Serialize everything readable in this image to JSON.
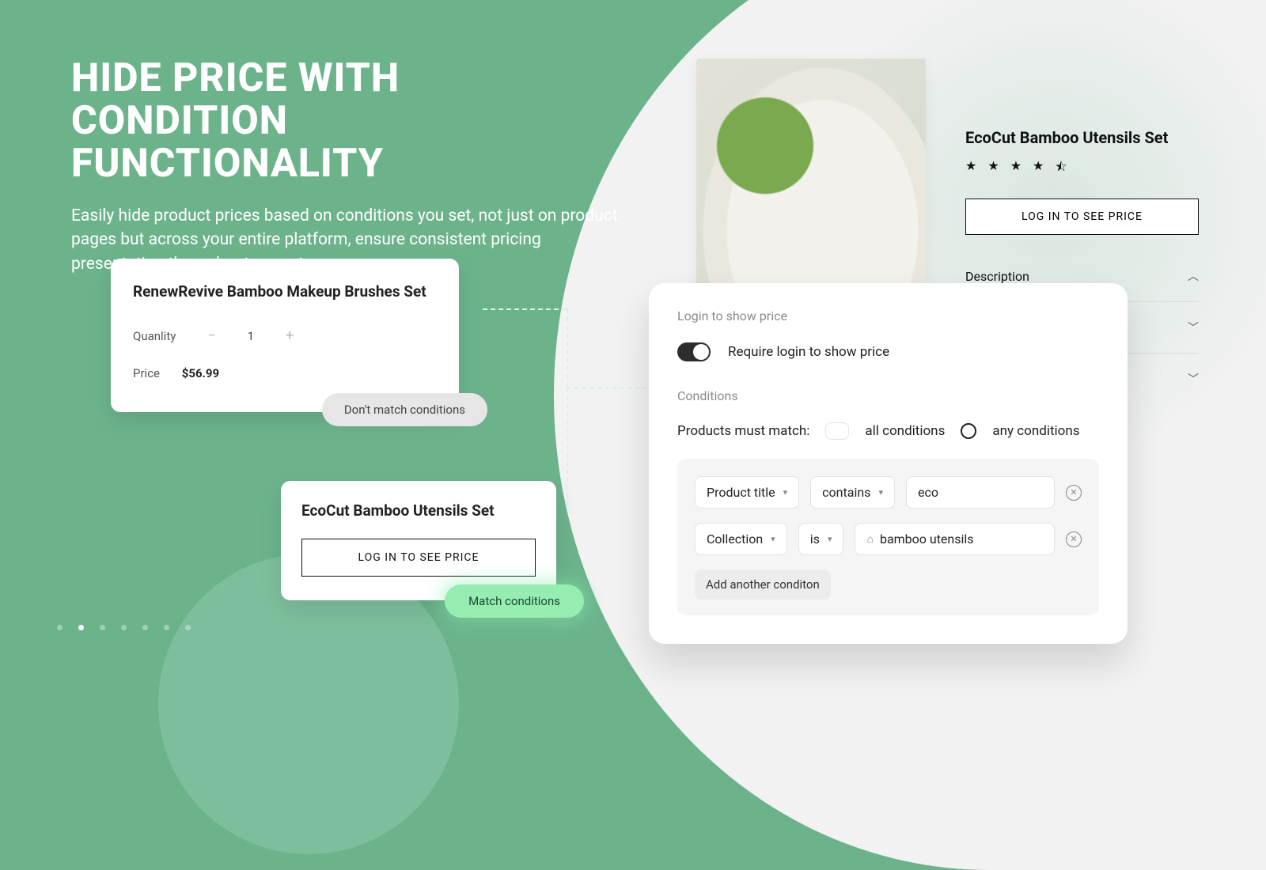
{
  "heading": {
    "title_line1": "HIDE PRICE WITH CONDITION",
    "title_line2": "FUNCTIONALITY",
    "subtitle": "Easily hide product prices based on conditions you set, not just on product pages but across your entire platform, ensure consistent pricing presentation throughout your store."
  },
  "card_a": {
    "title": "RenewRevive Bamboo Makeup Brushes Set",
    "qty_label": "Quanlity",
    "qty_value": "1",
    "price_label": "Price",
    "price_value": "$56.99",
    "badge": "Don't match conditions"
  },
  "card_b": {
    "title": "EcoCut Bamboo Utensils Set",
    "login_btn": "LOG IN TO SEE PRICE",
    "badge": "Match conditions"
  },
  "product": {
    "title": "EcoCut Bamboo Utensils Set",
    "login_btn": "LOG IN TO SEE PRICE",
    "acc1": "Description"
  },
  "settings": {
    "section1": "Login to show price",
    "toggle_label": "Require login to show price",
    "section2": "Conditions",
    "match_prompt": "Products must match:",
    "match_all": "all conditions",
    "match_any": "any conditions",
    "row1_field": "Product title",
    "row1_op": "contains",
    "row1_val": "eco",
    "row2_field": "Collection",
    "row2_op": "is",
    "row2_val": "bamboo utensils",
    "add": "Add another conditon"
  },
  "carousel_active_index": 1,
  "carousel_count": 7
}
